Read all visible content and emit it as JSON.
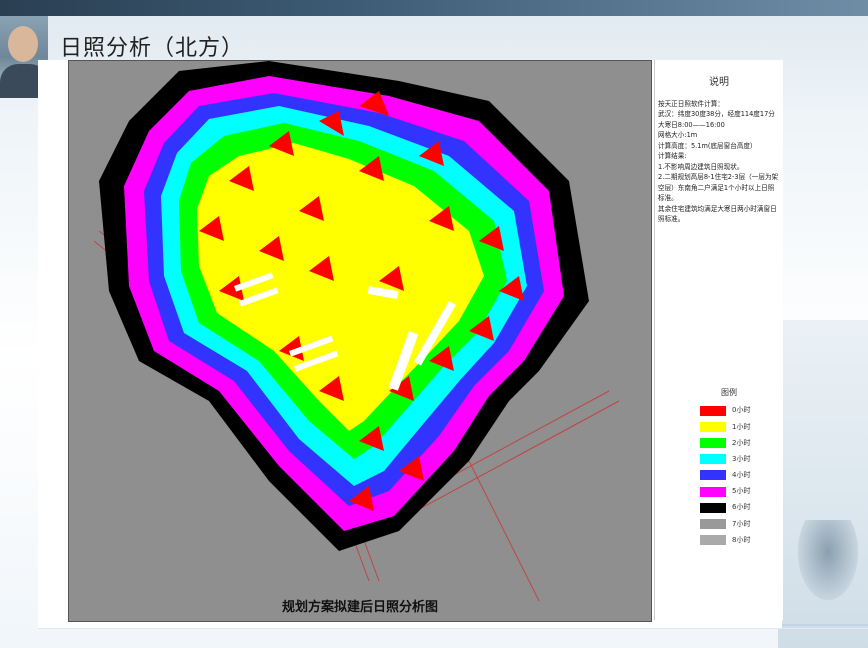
{
  "slide": {
    "title": "日照分析（北方）"
  },
  "map": {
    "caption": "规划方案拟建后日照分析图",
    "background_color": "#8f8f8f"
  },
  "notes": {
    "heading": "说明",
    "lines": [
      "按天正日照软件计算：",
      "武汉：纬度30度38分，经度114度17分",
      "大寒日8:00——16:00",
      "网格大小:1m",
      "计算高度：5.1m(底层窗台高度）",
      "计算结果:",
      "1.不影响周边建筑日照现状。",
      "2.二期规划高层8-1住宅2-3层（一层为架空层）东南角二户满足1个小时以上日照标准。",
      "其余住宅建筑均满足大寒日两小时满窗日照标准。"
    ]
  },
  "legend": {
    "title": "图例",
    "items": [
      {
        "label": "0小时",
        "color": "#ff0000"
      },
      {
        "label": "1小时",
        "color": "#ffff00"
      },
      {
        "label": "2小时",
        "color": "#00ff00"
      },
      {
        "label": "3小时",
        "color": "#00ffff"
      },
      {
        "label": "4小时",
        "color": "#3333ff"
      },
      {
        "label": "5小时",
        "color": "#ff00ff"
      },
      {
        "label": "6小时",
        "color": "#000000"
      },
      {
        "label": "7小时",
        "color": "#999999"
      },
      {
        "label": "8小时",
        "color": "#aaaaaa"
      }
    ]
  }
}
